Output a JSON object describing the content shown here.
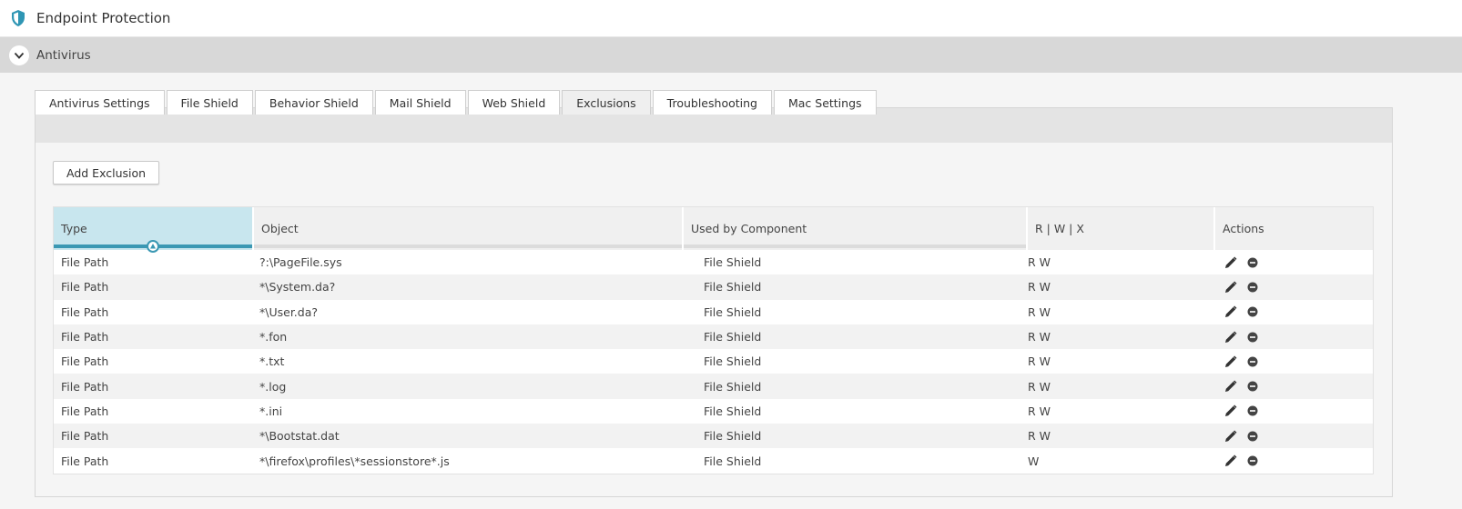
{
  "header": {
    "title": "Endpoint Protection",
    "icon": "shield-icon",
    "accent": "#2f96b4"
  },
  "section": {
    "label": "Antivirus",
    "icon": "chevron-down-icon"
  },
  "tabs": [
    {
      "label": "Antivirus Settings"
    },
    {
      "label": "File Shield"
    },
    {
      "label": "Behavior Shield"
    },
    {
      "label": "Mail Shield"
    },
    {
      "label": "Web Shield"
    },
    {
      "label": "Exclusions",
      "active": true
    },
    {
      "label": "Troubleshooting"
    },
    {
      "label": "Mac Settings"
    }
  ],
  "toolbar": {
    "add_label": "Add Exclusion"
  },
  "table": {
    "columns": [
      "Type",
      "Object",
      "Used by Component",
      "R | W | X",
      "Actions"
    ],
    "sorted_column": "Type",
    "rows": [
      {
        "type": "File Path",
        "object": "?:\\PageFile.sys",
        "component": "File Shield",
        "rwx": "R W"
      },
      {
        "type": "File Path",
        "object": "*\\System.da?",
        "component": "File Shield",
        "rwx": "R W"
      },
      {
        "type": "File Path",
        "object": "*\\User.da?",
        "component": "File Shield",
        "rwx": "R W"
      },
      {
        "type": "File Path",
        "object": "*.fon",
        "component": "File Shield",
        "rwx": "R W"
      },
      {
        "type": "File Path",
        "object": "*.txt",
        "component": "File Shield",
        "rwx": "R W"
      },
      {
        "type": "File Path",
        "object": "*.log",
        "component": "File Shield",
        "rwx": "R W"
      },
      {
        "type": "File Path",
        "object": "*.ini",
        "component": "File Shield",
        "rwx": "R W"
      },
      {
        "type": "File Path",
        "object": "*\\Bootstat.dat",
        "component": "File Shield",
        "rwx": "R W"
      },
      {
        "type": "File Path",
        "object": "*\\firefox\\profiles\\*sessionstore*.js",
        "component": "File Shield",
        "rwx": "W"
      }
    ]
  }
}
